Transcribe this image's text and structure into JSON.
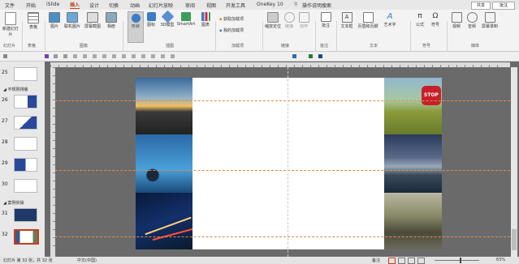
{
  "menubar": {
    "items": [
      "文件",
      "开始",
      "iSlide",
      "插入",
      "设计",
      "切换",
      "动画",
      "幻灯片放映",
      "审阅",
      "视图",
      "开发工具",
      "OneKey 10",
      "操作说明搜索"
    ],
    "active": "插入",
    "share": "共享",
    "comment": "批注"
  },
  "ribbon": {
    "buttons": [
      "新建幻灯片",
      "表格",
      "图片",
      "联机图片",
      "屏幕截图",
      "相册",
      "形状",
      "图标",
      "3D模型",
      "SmartArt",
      "图表",
      "获取加载项",
      "我的加载项",
      "缩放定位",
      "链接",
      "动作",
      "批注",
      "文本框",
      "页眉和页脚",
      "艺术字",
      "公式",
      "符号",
      "视频",
      "音频",
      "屏幕录制"
    ],
    "groups": [
      "幻灯片",
      "表格",
      "图像",
      "插图",
      "加载项",
      "链接",
      "批注",
      "文本",
      "符号",
      "媒体"
    ]
  },
  "colors": {
    "accent": "#c43e1c",
    "ribbon": "#f3f3f3",
    "canvas": "#6a6a6a",
    "guide": "#e08a4a"
  },
  "slides": {
    "numbers": [
      "25",
      "26",
      "27",
      "28",
      "29",
      "30",
      "31",
      "32"
    ],
    "sections": [
      "不规则排版",
      "案例实操"
    ],
    "selected": "32"
  },
  "slide_photos": [
    "sunset-road",
    "blue-rock-sea",
    "night-light-trails",
    "stop-sign",
    "stormy-lake",
    "misty-city"
  ],
  "status": {
    "slide_info": "幻灯片 第 32 张，共 32 张",
    "language": "中文(中国)",
    "notes": "备注",
    "zoom": "63%"
  }
}
